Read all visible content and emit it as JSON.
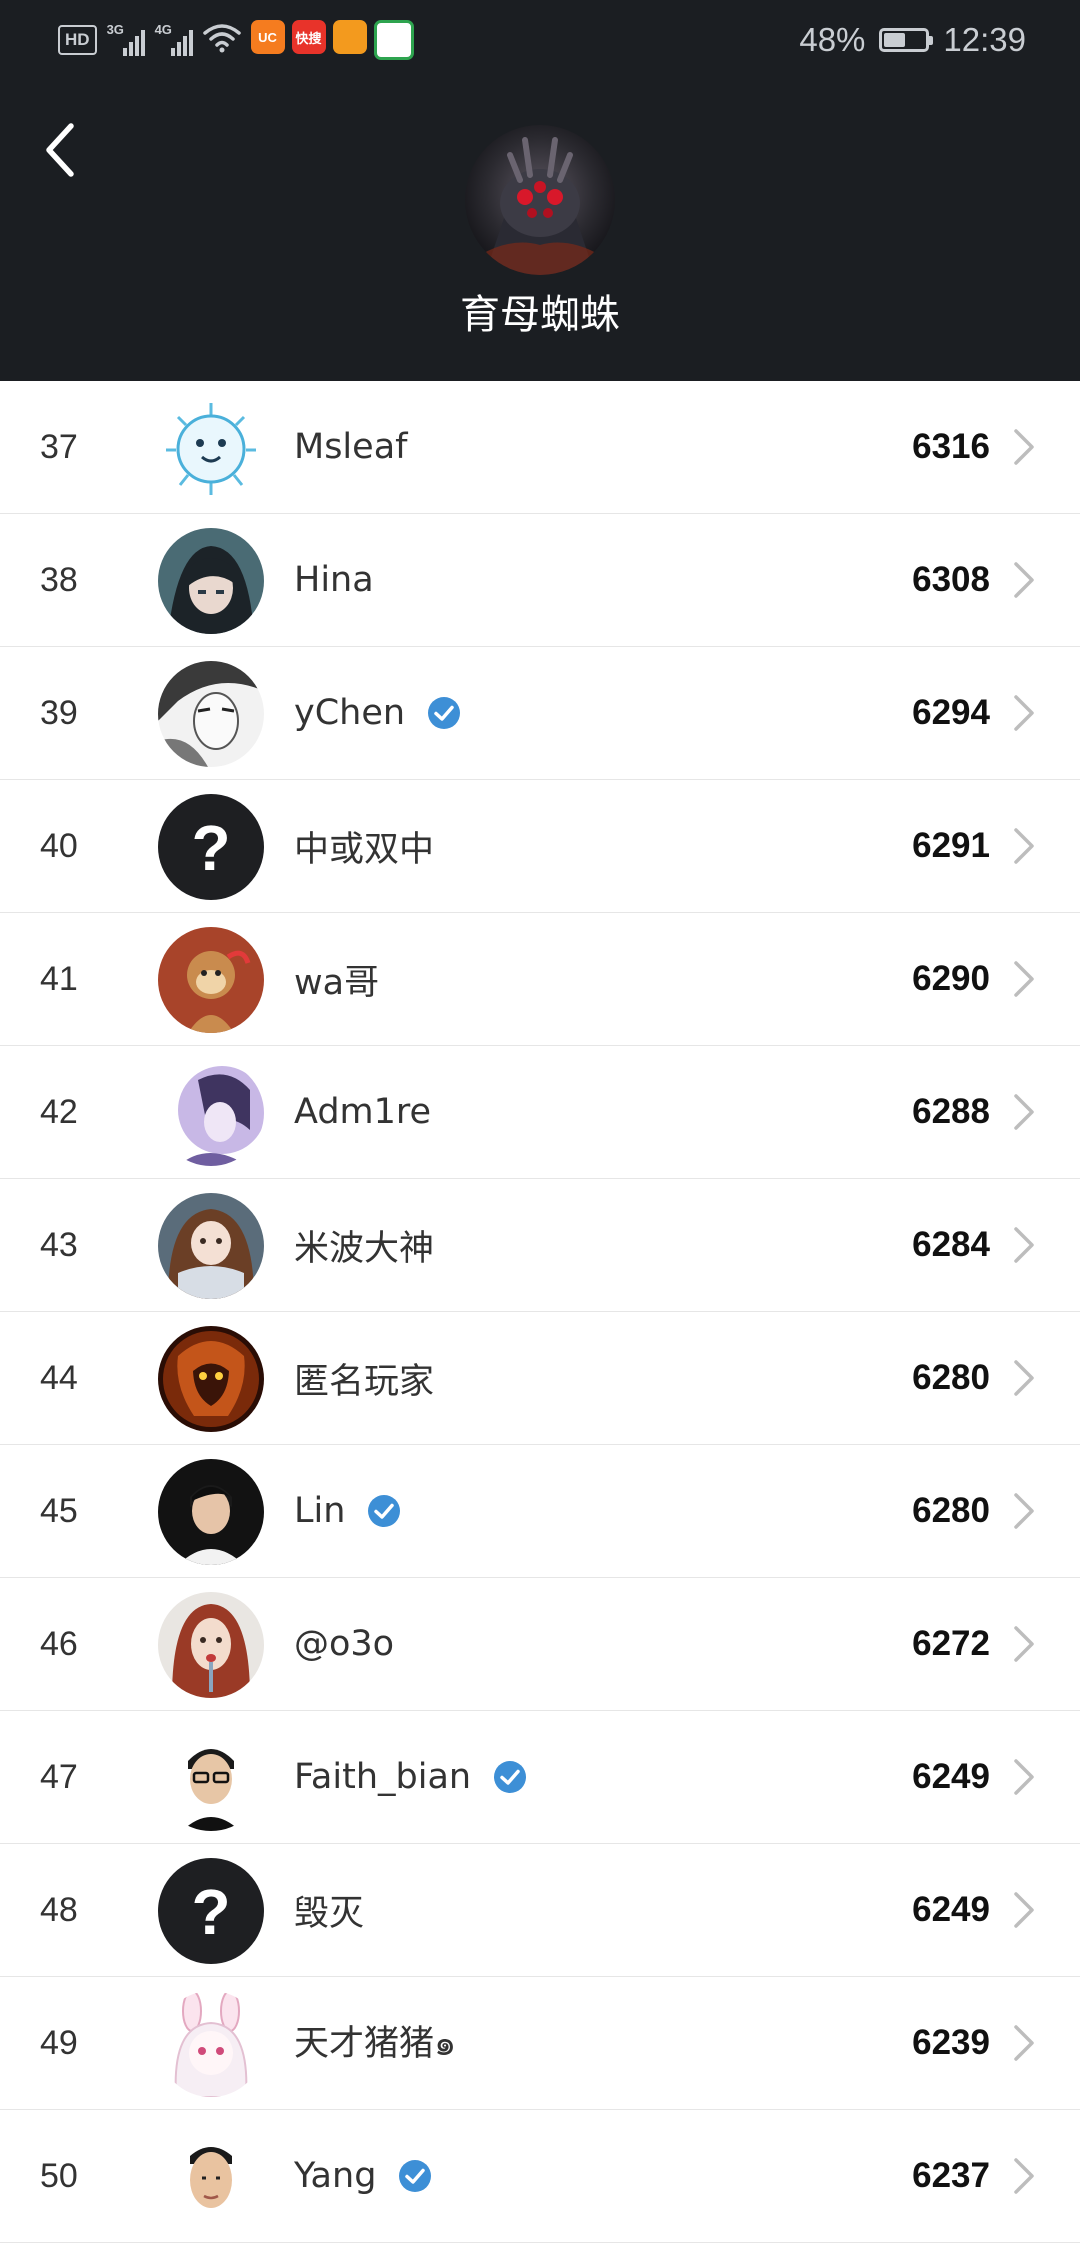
{
  "status_bar": {
    "hd_label": "HD",
    "signal1_tag": "3G",
    "signal2_tag": "4G",
    "app_icons": [
      {
        "name": "uc-browser-icon",
        "label": "UC",
        "color": "#f57c1f"
      },
      {
        "name": "kuaisou-icon",
        "label": "快搜",
        "color": "#e8332a"
      },
      {
        "name": "app3-icon",
        "label": "",
        "color": "#f39a1e"
      },
      {
        "name": "app4-icon",
        "label": "",
        "color": "#ffffff"
      }
    ],
    "battery_percent": "48%",
    "battery_level": 0.48,
    "time": "12:39"
  },
  "header": {
    "hero_name": "育母蜘蛛",
    "background": "#1b1e22"
  },
  "leaderboard": {
    "rows": [
      {
        "rank": "37",
        "name": "Msleaf",
        "verified": false,
        "score": "6316",
        "avatar": "virus"
      },
      {
        "rank": "38",
        "name": "Hina",
        "verified": false,
        "score": "6308",
        "avatar": "anime-dark"
      },
      {
        "rank": "39",
        "name": "yChen",
        "verified": true,
        "score": "6294",
        "avatar": "sketch"
      },
      {
        "rank": "40",
        "name": "中或双中",
        "verified": false,
        "score": "6291",
        "avatar": "unknown"
      },
      {
        "rank": "41",
        "name": "wa哥",
        "verified": false,
        "score": "6290",
        "avatar": "monkey"
      },
      {
        "rank": "42",
        "name": "Adm1re",
        "verified": false,
        "score": "6288",
        "avatar": "purple"
      },
      {
        "rank": "43",
        "name": "米波大神",
        "verified": false,
        "score": "6284",
        "avatar": "anime-girl"
      },
      {
        "rank": "44",
        "name": "匿名玩家",
        "verified": false,
        "score": "6280",
        "avatar": "fire-demon"
      },
      {
        "rank": "45",
        "name": "Lin",
        "verified": true,
        "score": "6280",
        "avatar": "photo-dark"
      },
      {
        "rank": "46",
        "name": "@o3o",
        "verified": false,
        "score": "6272",
        "avatar": "redhair"
      },
      {
        "rank": "47",
        "name": "Faith_bian",
        "verified": true,
        "score": "6249",
        "avatar": "photo-glasses"
      },
      {
        "rank": "48",
        "name": "毁灭",
        "verified": false,
        "score": "6249",
        "avatar": "unknown"
      },
      {
        "rank": "49",
        "name": "天才猪猪๑",
        "verified": false,
        "score": "6239",
        "avatar": "bunny"
      },
      {
        "rank": "50",
        "name": "Yang",
        "verified": true,
        "score": "6237",
        "avatar": "photo-face"
      }
    ]
  },
  "colors": {
    "verified_blue": "#3d8fd6",
    "rank_text": "#333333",
    "score_text": "#111111",
    "chevron": "#bdbdbd",
    "divider": "#e6e6e6"
  }
}
